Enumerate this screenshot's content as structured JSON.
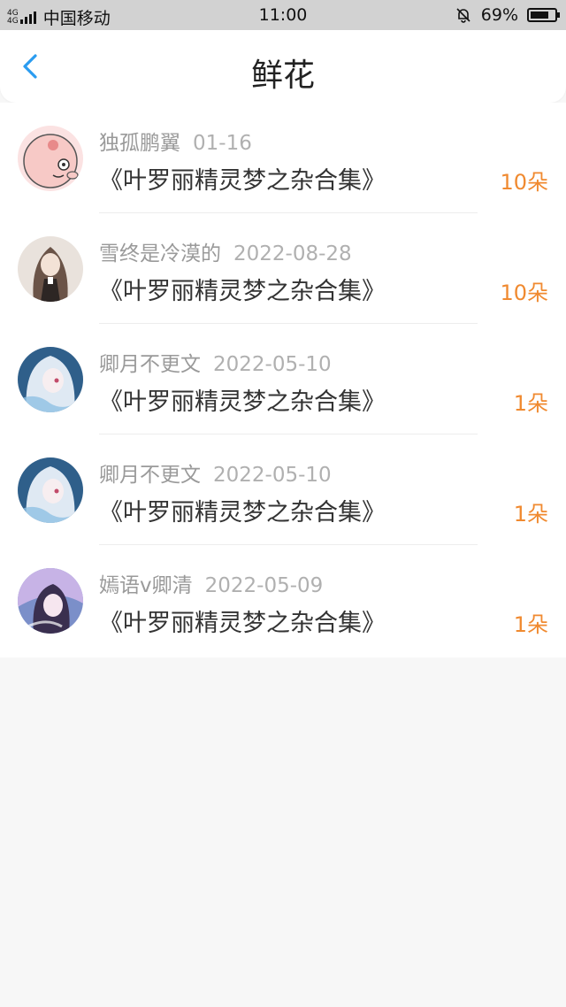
{
  "status_bar": {
    "network": "4G",
    "carrier": "中国移动",
    "time": "11:00",
    "battery": "69%"
  },
  "nav": {
    "title": "鲜花"
  },
  "records": [
    {
      "user": "独孤鹏翼",
      "date": "01-16",
      "book": "《叶罗丽精灵梦之杂合集》",
      "count": "10朵"
    },
    {
      "user": "雪终是冷漠的",
      "date": "2022-08-28",
      "book": "《叶罗丽精灵梦之杂合集》",
      "count": "10朵"
    },
    {
      "user": "卿月不更文",
      "date": "2022-05-10",
      "book": "《叶罗丽精灵梦之杂合集》",
      "count": "1朵"
    },
    {
      "user": "卿月不更文",
      "date": "2022-05-10",
      "book": "《叶罗丽精灵梦之杂合集》",
      "count": "1朵"
    },
    {
      "user": "嫣语v卿清",
      "date": "2022-05-09",
      "book": "《叶罗丽精灵梦之杂合集》",
      "count": "1朵"
    }
  ],
  "colors": {
    "accent": "#2a9cf0",
    "count": "#f08a30"
  }
}
